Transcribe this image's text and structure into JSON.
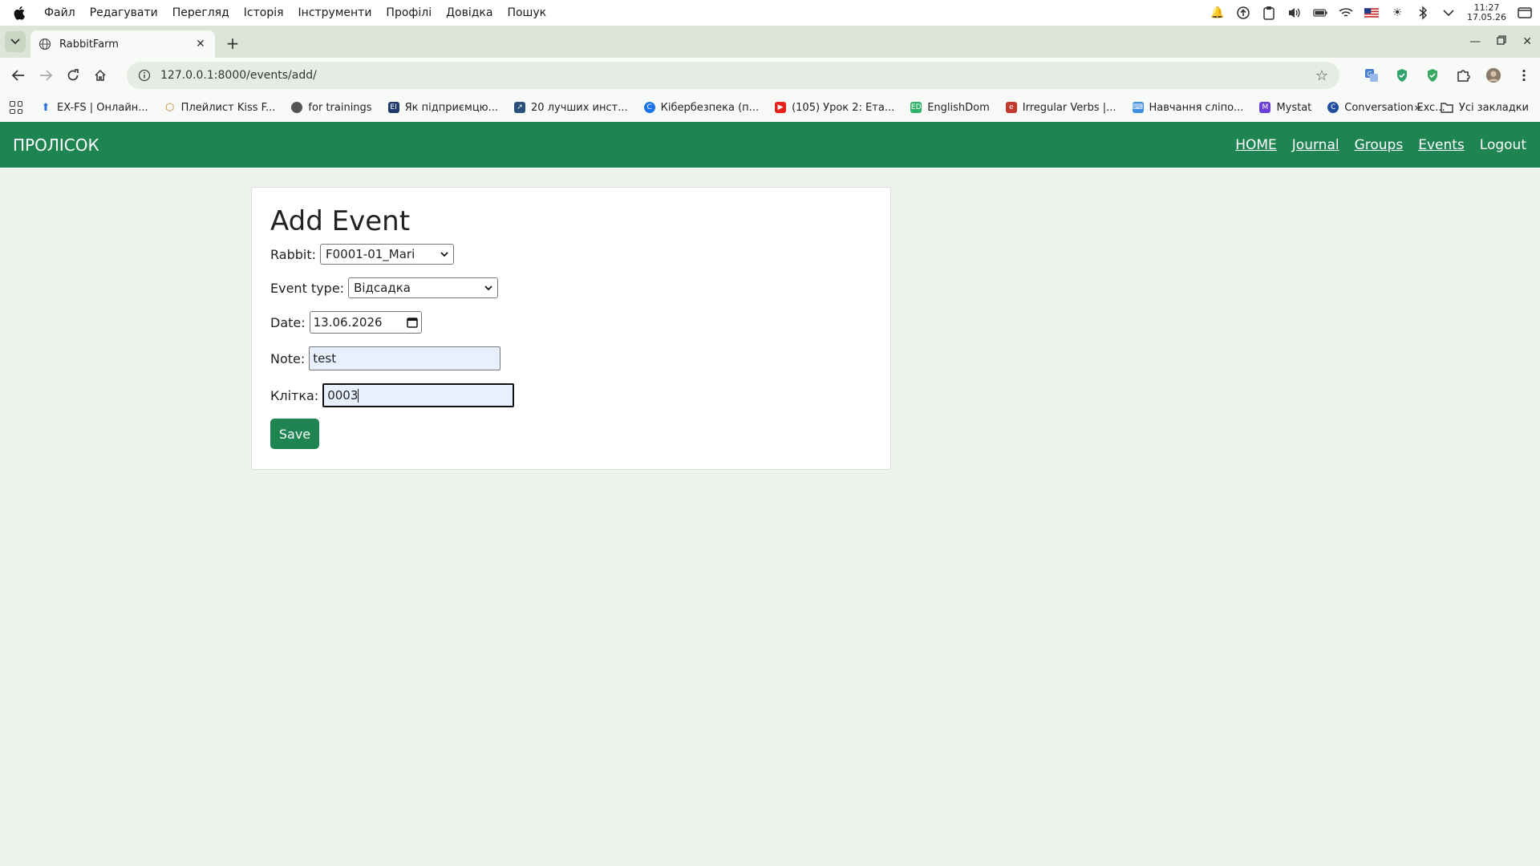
{
  "os_menu": {
    "items": [
      "Файл",
      "Редагувати",
      "Перегляд",
      "Історія",
      "Інструменти",
      "Профілі",
      "Довідка",
      "Пошук"
    ],
    "clock_time": "11:27",
    "clock_date": "17.05.26"
  },
  "browser": {
    "tab_title": "RabbitFarm",
    "url": "127.0.0.1:8000/events/add/",
    "bookmarks": [
      {
        "label": "EX-FS | Онлайн...",
        "color": "#2a6fdb"
      },
      {
        "label": "Плейлист Kiss F...",
        "color": "#c8853a"
      },
      {
        "label": "for trainings",
        "color": "#555555"
      },
      {
        "label": "Як підприємцю...",
        "color": "#1f3a6b"
      },
      {
        "label": "20 лучших инст...",
        "color": "#2a4f7a"
      },
      {
        "label": "Кібербезпека (п...",
        "color": "#1a73e8"
      },
      {
        "label": "(105) Урок 2: Ета...",
        "color": "#e62117"
      },
      {
        "label": "EnglishDom",
        "color": "#2fb36a"
      },
      {
        "label": "Irregular Verbs |...",
        "color": "#c0392b"
      },
      {
        "label": "Навчання сліпо...",
        "color": "#3d8de0"
      },
      {
        "label": "Mystat",
        "color": "#6b3fd6"
      },
      {
        "label": "Conversation Exc...",
        "color": "#1f4e9c"
      }
    ],
    "all_bookmarks": "Усі закладки"
  },
  "site": {
    "brand": "ПРОЛІСОК",
    "nav": {
      "home": "HOME",
      "journal": "Journal",
      "groups": "Groups",
      "events": "Events",
      "logout": "Logout"
    }
  },
  "form": {
    "title": "Add Event",
    "rabbit_label": "Rabbit:",
    "rabbit_value": "F0001-01_Mari",
    "event_type_label": "Event type:",
    "event_type_value": "Відсадка",
    "date_label": "Date:",
    "date_value": "13.06.2026",
    "note_label": "Note:",
    "note_value": "test",
    "cage_label": "Клітка:",
    "cage_value": "0003",
    "save_label": "Save"
  },
  "colors": {
    "brand_green": "#1e8452",
    "page_bg": "#eef2ec"
  }
}
